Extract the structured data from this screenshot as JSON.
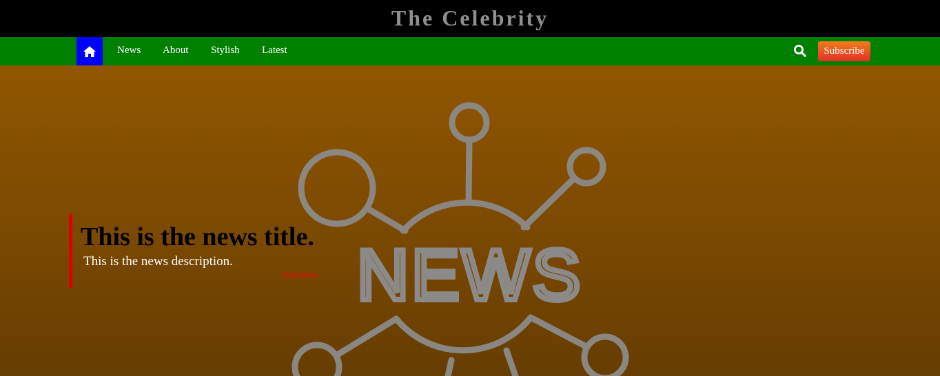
{
  "header": {
    "title": "The Celebrity",
    "background_color": "#000000",
    "title_color": "#8f8f8f"
  },
  "navbar": {
    "background_color": "#008000",
    "home_icon": "home-icon",
    "home_background_color": "#0000ff",
    "links": [
      {
        "label": "News"
      },
      {
        "label": "About"
      },
      {
        "label": "Stylish"
      },
      {
        "label": "Latest"
      }
    ],
    "search_icon": "search-icon",
    "subscribe_label": "Subscribe",
    "subscribe_colors": [
      "#f07d1a",
      "#e0302a"
    ]
  },
  "hero": {
    "background_colors": [
      "#915600",
      "#663d02"
    ],
    "art_text": "NEWS",
    "art_icon": "news-network-icon",
    "card": {
      "accent_color": "#e00000",
      "title": "This is the news title.",
      "description": "This is the news description.",
      "link_label": "click here",
      "link_color": "#ff0000"
    }
  }
}
